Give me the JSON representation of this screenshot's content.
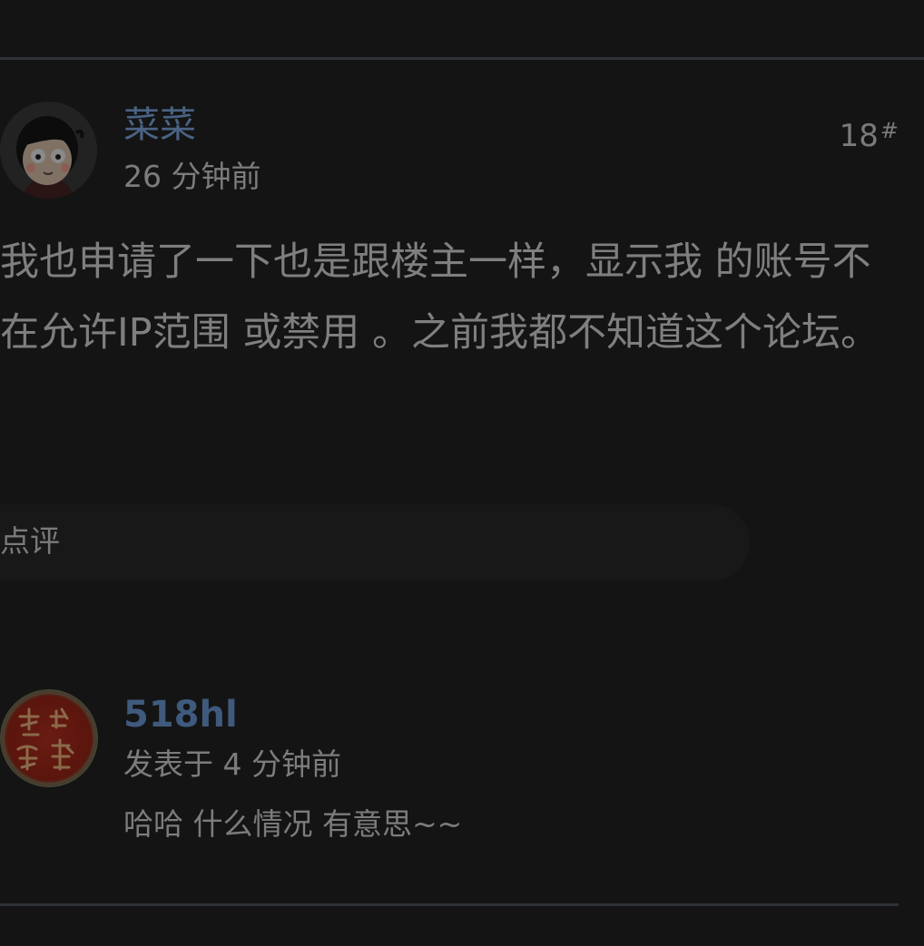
{
  "post": {
    "author": "菜菜",
    "time": "26 分钟前",
    "floor_number": "18",
    "floor_mark": "#",
    "body": "我也申请了一下也是跟楼主一样，显示我 的账号不在允许IP范围 或禁用 。之前我都不知道这个论坛。",
    "comment_label": "点评"
  },
  "reply": {
    "author": "518hl",
    "meta": "发表于 4 分钟前",
    "text": "哈哈 什么情况 有意思~~"
  }
}
